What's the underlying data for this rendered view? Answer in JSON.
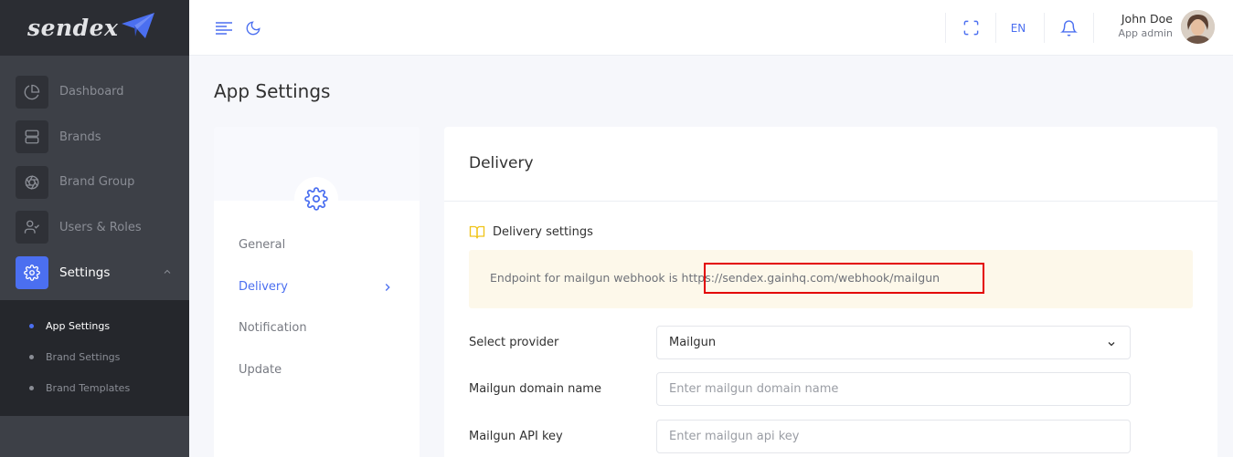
{
  "brand": {
    "name": "sendex"
  },
  "sidebar": {
    "items": [
      {
        "label": "Dashboard",
        "icon": "pie-chart-icon"
      },
      {
        "label": "Brands",
        "icon": "server-icon"
      },
      {
        "label": "Brand Group",
        "icon": "aperture-icon"
      },
      {
        "label": "Users & Roles",
        "icon": "user-check-icon"
      },
      {
        "label": "Settings",
        "icon": "settings-icon"
      }
    ],
    "submenu": [
      {
        "label": "App Settings"
      },
      {
        "label": "Brand Settings"
      },
      {
        "label": "Brand Templates"
      }
    ]
  },
  "topbar": {
    "language": "EN",
    "user_name": "John Doe",
    "user_role": "App admin"
  },
  "page": {
    "title": "App Settings"
  },
  "settings_tabs": [
    {
      "label": "General"
    },
    {
      "label": "Delivery"
    },
    {
      "label": "Notification"
    },
    {
      "label": "Update"
    }
  ],
  "delivery": {
    "title": "Delivery",
    "section_title": "Delivery settings",
    "note_text": "Endpoint for mailgun webhook is ",
    "note_url": "https://sendex.gainhq.com/webhook/mailgun",
    "fields": {
      "provider_label": "Select provider",
      "provider_value": "Mailgun",
      "domain_label": "Mailgun domain name",
      "domain_placeholder": "Enter mailgun domain name",
      "api_key_label": "Mailgun API key",
      "api_key_placeholder": "Enter mailgun api key"
    }
  },
  "colors": {
    "accent": "#4b6ff0",
    "sidebar_bg": "#3d4047",
    "note_bg": "#fdf8ea",
    "highlight": "#e30000"
  }
}
